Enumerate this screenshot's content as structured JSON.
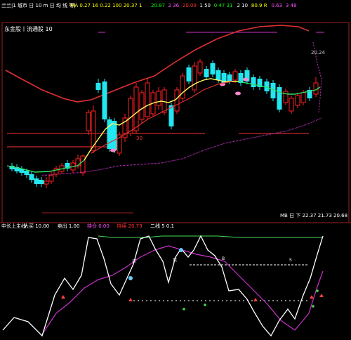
{
  "top_bar": {
    "segments": [
      {
        "text": "兰兰|1 城市 日 10 m 日 均 线 等|",
        "color": "#ffffff"
      },
      {
        "text": "MA 0.27 16 0.22 100 20.37 1",
        "color": "#ffff00"
      },
      {
        "text": "20.87",
        "color": "#00ff00"
      },
      {
        "text": "2 36",
        "color": "#ff55ff"
      },
      {
        "text": "20.09",
        "color": "#ff3030"
      },
      {
        "text": "1 50",
        "color": "#ffffff"
      },
      {
        "text": "0 47 31",
        "color": "#00ff00"
      },
      {
        "text": "2 10",
        "color": "#ffffff"
      },
      {
        "text": "80.9 R",
        "color": "#ffff00"
      },
      {
        "text": "0.63",
        "color": "#ff55ff"
      },
      {
        "text": "3 48",
        "color": "#ff55ff"
      }
    ]
  },
  "main_panel": {
    "indicator_label": "东金股丨流通股 10",
    "price_label": "20.24",
    "bottom_right_label": "MB 日 下 22.37 21.73 20.68",
    "marker_30": "30"
  },
  "sub_panel": {
    "title_segments": [
      {
        "text": "中长上主线",
        "color": "#ffffff"
      },
      {
        "text": "大买 10.00",
        "color": "#ffffff"
      },
      {
        "text": "卖出 1.00",
        "color": "#ffffff"
      },
      {
        "text": "持仓 0.00",
        "color": "#ff55ff"
      },
      {
        "text": "持续 20.79",
        "color": "#ff3030"
      },
      {
        "text": "二线 5 0.1",
        "color": "#ffffff"
      }
    ],
    "signal_labels": [
      "买",
      "卖",
      "B",
      "S"
    ]
  },
  "colors": {
    "background": "#000000",
    "frame": "#9a2020",
    "up_candle": "#ff2020",
    "down_candle": "#22e6f0",
    "ma_red": "#e03030",
    "ma_yellow": "#ffff60",
    "ma_green": "#30e060",
    "ma_magenta": "#cc33cc",
    "osc_white": "#ffffff",
    "osc_magenta": "#cc33cc",
    "osc_green": "#44dd55"
  }
}
